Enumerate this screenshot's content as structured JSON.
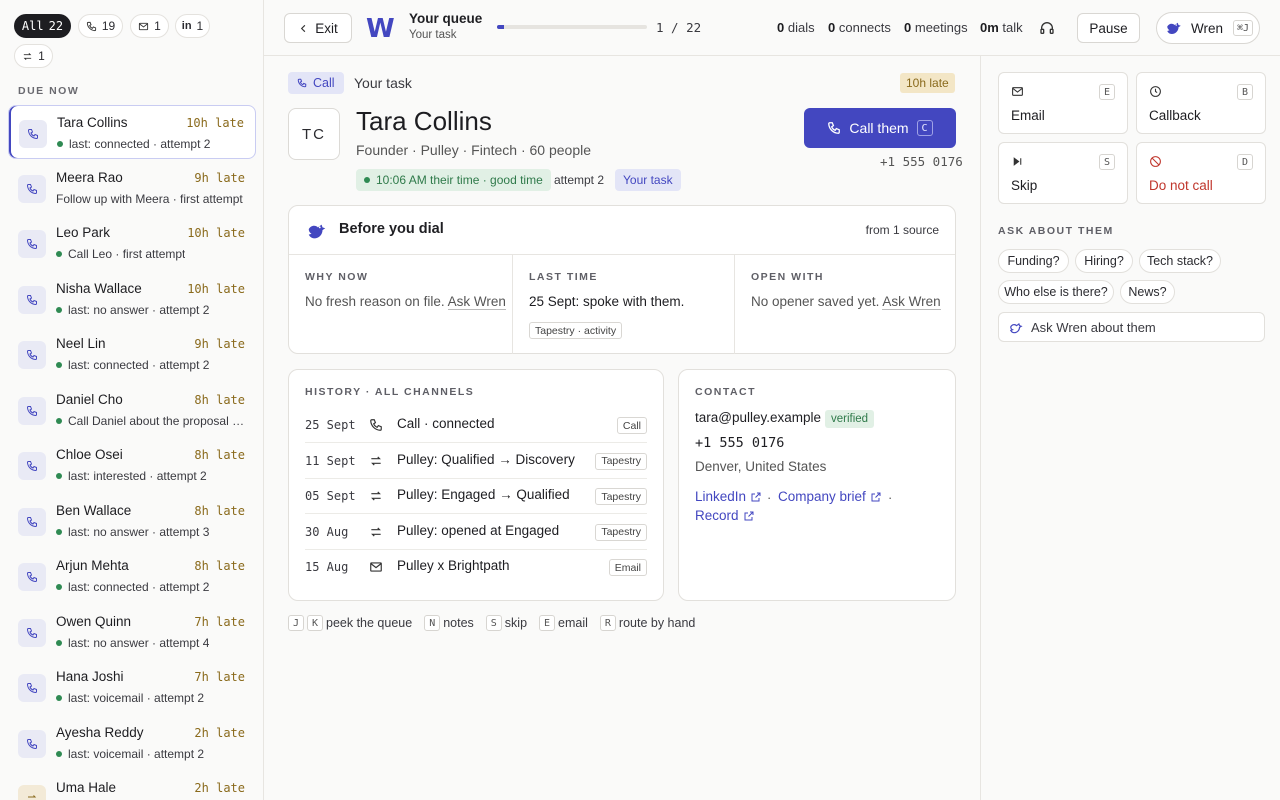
{
  "sidebar": {
    "filters": {
      "all_label": "All",
      "all_count": "22",
      "calls": "19",
      "emails": "1",
      "linkedin_label": "in",
      "linkedin": "1",
      "routes": "1"
    },
    "section_title": "DUE NOW",
    "items": [
      {
        "name": "Tara Collins",
        "late": "10h late",
        "sub": "last: connected · attempt 2",
        "dot": true
      },
      {
        "name": "Meera Rao",
        "late": "9h late",
        "sub": "Follow up with Meera · first attempt",
        "dot": false
      },
      {
        "name": "Leo Park",
        "late": "10h late",
        "sub": "Call Leo · first attempt",
        "dot": true
      },
      {
        "name": "Nisha Wallace",
        "late": "10h late",
        "sub": "last: no answer · attempt 2",
        "dot": true
      },
      {
        "name": "Neel Lin",
        "late": "9h late",
        "sub": "last: connected · attempt 2",
        "dot": true
      },
      {
        "name": "Daniel Cho",
        "late": "8h late",
        "sub": "Call Daniel about the proposal · first attempt",
        "dot": true
      },
      {
        "name": "Chloe Osei",
        "late": "8h late",
        "sub": "last: interested · attempt 2",
        "dot": true
      },
      {
        "name": "Ben Wallace",
        "late": "8h late",
        "sub": "last: no answer · attempt 3",
        "dot": true
      },
      {
        "name": "Arjun Mehta",
        "late": "8h late",
        "sub": "last: connected · attempt 2",
        "dot": true
      },
      {
        "name": "Owen Quinn",
        "late": "7h late",
        "sub": "last: no answer · attempt 4",
        "dot": true
      },
      {
        "name": "Hana Joshi",
        "late": "7h late",
        "sub": "last: voicemail · attempt 2",
        "dot": true
      },
      {
        "name": "Ayesha Reddy",
        "late": "2h late",
        "sub": "last: voicemail · attempt 2",
        "dot": true
      },
      {
        "name": "Uma Hale",
        "late": "2h late",
        "sub": "",
        "dot": false
      }
    ]
  },
  "topbar": {
    "exit_label": "Exit",
    "logo": "W",
    "queue_title": "Your queue",
    "queue_subtitle": "Your task",
    "progress_fraction": 0.045,
    "position": "1 / 22",
    "dials_count": "0",
    "dials_label": "dials",
    "connects_count": "0",
    "connects_label": "connects",
    "meetings_count": "0",
    "meetings_label": "meetings",
    "talk_count": "0m",
    "talk_label": "talk",
    "pause_label": "Pause",
    "user_name": "Wren",
    "user_shortcut": "⌘J"
  },
  "main": {
    "type_tag": "Call",
    "task_label": "Your task",
    "late_badge": "10h late",
    "initials": "TC",
    "name": "Tara Collins",
    "meta": "Founder · Pulley · Fintech · 60 people",
    "time_pill": "10:06 AM their time · good time",
    "attempt": "attempt 2",
    "task_pill": "Your task",
    "call_label": "Call them",
    "call_shortcut": "C",
    "phone": "+1 555 0176",
    "before_dial": {
      "title": "Before you dial",
      "source": "from 1 source",
      "why_now_head": "WHY NOW",
      "why_now_text": "No fresh reason on file.",
      "why_now_link": "Ask Wren",
      "last_time_head": "LAST TIME",
      "last_time_text": "25 Sept: spoke with them.",
      "last_time_tag": "Tapestry · activity",
      "open_with_head": "OPEN WITH",
      "open_with_text": "No opener saved yet.",
      "open_with_link": "Ask Wren"
    },
    "history": {
      "title": "HISTORY · ALL CHANNELS",
      "rows": [
        {
          "date": "25 Sept",
          "icon": "phone-icon",
          "text": "Call · connected",
          "badge": "Call"
        },
        {
          "date": "11 Sept",
          "icon": "route-icon",
          "text": "Pulley: Qualified → Discovery",
          "badge": "Tapestry"
        },
        {
          "date": "05 Sept",
          "icon": "route-icon",
          "text": "Pulley: Engaged → Qualified",
          "badge": "Tapestry"
        },
        {
          "date": "30 Aug",
          "icon": "route-icon",
          "text": "Pulley: opened at Engaged",
          "badge": "Tapestry"
        },
        {
          "date": "15 Aug",
          "icon": "mail-icon",
          "text": "Pulley x Brightpath",
          "badge": "Email"
        }
      ]
    },
    "contact": {
      "title": "CONTACT",
      "email": "tara@pulley.example",
      "verified": "verified",
      "phone": "+1 555 0176",
      "location": "Denver, United States",
      "linkedin": "LinkedIn",
      "company_brief": "Company brief",
      "record": "Record",
      "separator": "·"
    },
    "hints": [
      {
        "keys": [
          "J",
          "K"
        ],
        "label": "peek the queue"
      },
      {
        "keys": [
          "N"
        ],
        "label": "notes"
      },
      {
        "keys": [
          "S"
        ],
        "label": "skip"
      },
      {
        "keys": [
          "E"
        ],
        "label": "email"
      },
      {
        "keys": [
          "R"
        ],
        "label": "route by hand"
      }
    ]
  },
  "right": {
    "actions": [
      {
        "label": "Email",
        "key": "E",
        "icon": "mail-icon"
      },
      {
        "label": "Callback",
        "key": "B",
        "icon": "clock-icon"
      },
      {
        "label": "Skip",
        "key": "S",
        "icon": "skip-icon"
      },
      {
        "label": "Do not call",
        "key": "D",
        "icon": "ban-icon"
      }
    ],
    "ask_title": "ASK ABOUT THEM",
    "questions": [
      "Funding?",
      "Hiring?",
      "Tech stack?",
      "Who else is there?",
      "News?"
    ],
    "ask_placeholder": "Ask Wren about them"
  },
  "colors": {
    "accent": "#4347c0",
    "late": "#8a6a1c",
    "late_bg": "#f3e6c6",
    "good": "#2f7a4a",
    "danger": "#c0362c"
  }
}
